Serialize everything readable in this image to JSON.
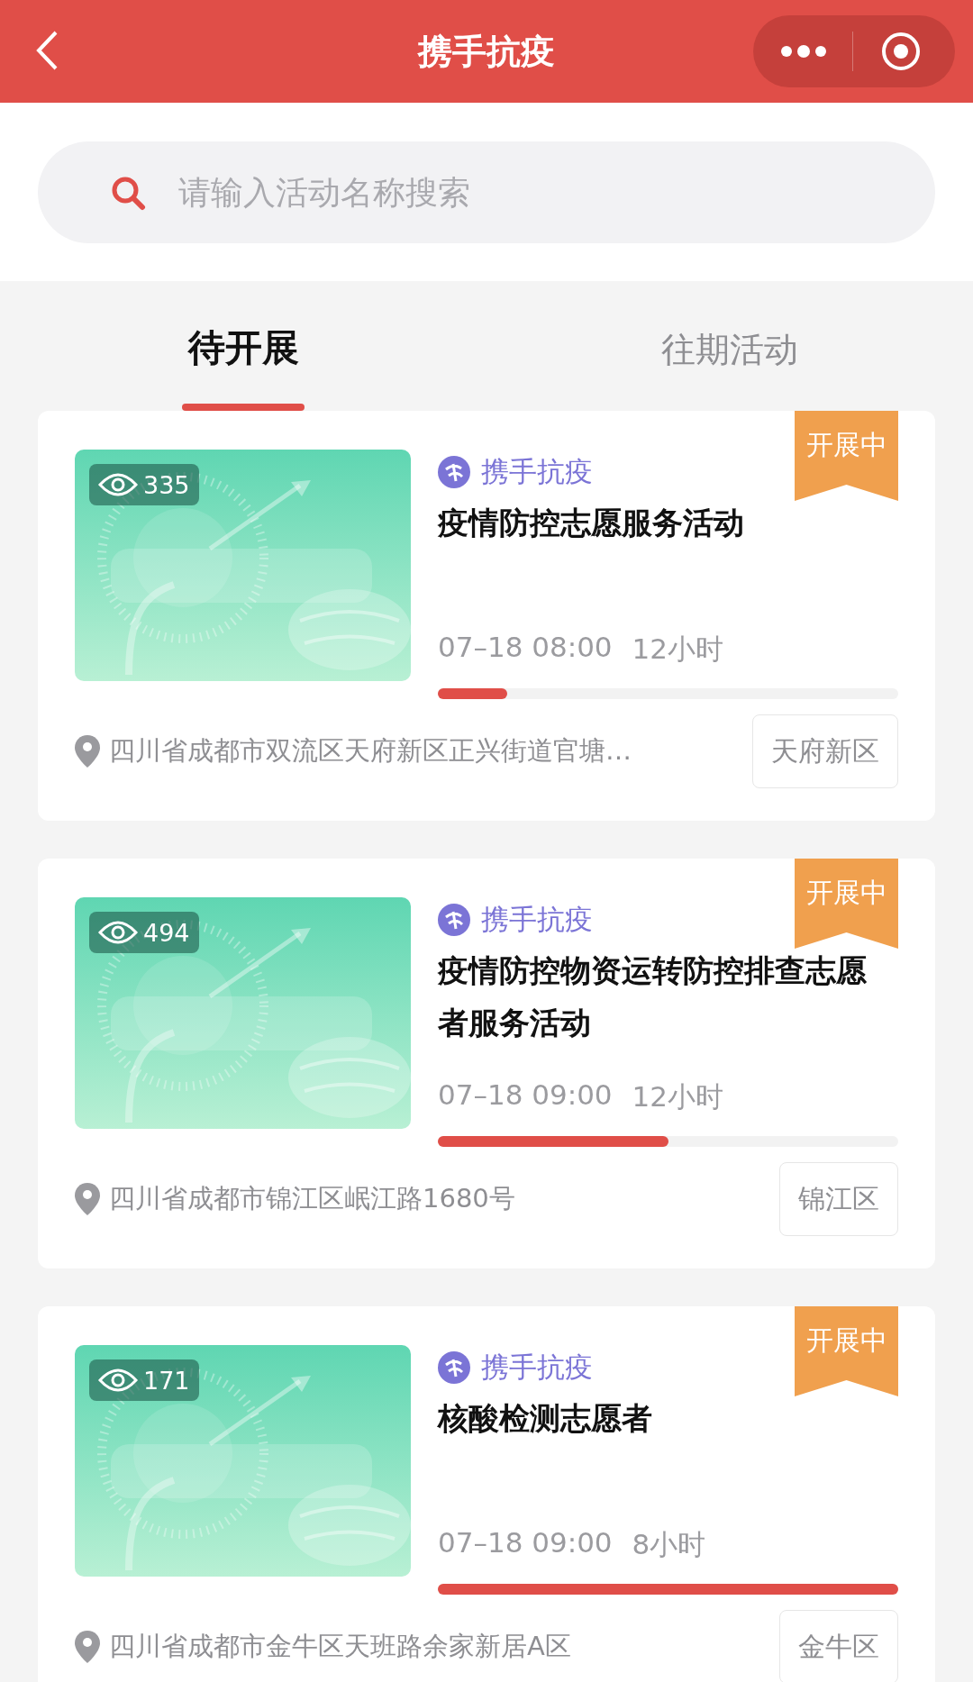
{
  "header": {
    "title": "携手抗疫"
  },
  "search": {
    "placeholder": "请输入活动名称搜索"
  },
  "tabs": [
    {
      "label": "待开展",
      "selected": true
    },
    {
      "label": "往期活动",
      "selected": false
    }
  ],
  "activities": [
    {
      "views": "335",
      "source": "携手抗疫",
      "title": "疫情防控志愿服务活动",
      "time": "07–18 08:00",
      "duration": "12小时",
      "level": 0.15,
      "status": "开展中",
      "address": "四川省成都市双流区天府新区正兴街道官塘…",
      "district": "天府新区"
    },
    {
      "views": "494",
      "source": "携手抗疫",
      "title": "疫情防控物资运转防控排查志愿者服务活动",
      "time": "07–18 09:00",
      "duration": "12小时",
      "level": 0.5,
      "status": "开展中",
      "address": "四川省成都市锦江区岷江路1680号",
      "district": "锦江区"
    },
    {
      "views": "171",
      "source": "携手抗疫",
      "title": "核酸检测志愿者",
      "time": "07–18 09:00",
      "duration": "8小时",
      "level": 1.0,
      "status": "开展中",
      "address": "四川省成都市金牛区天班路余家新居A区",
      "district": "金牛区"
    }
  ]
}
